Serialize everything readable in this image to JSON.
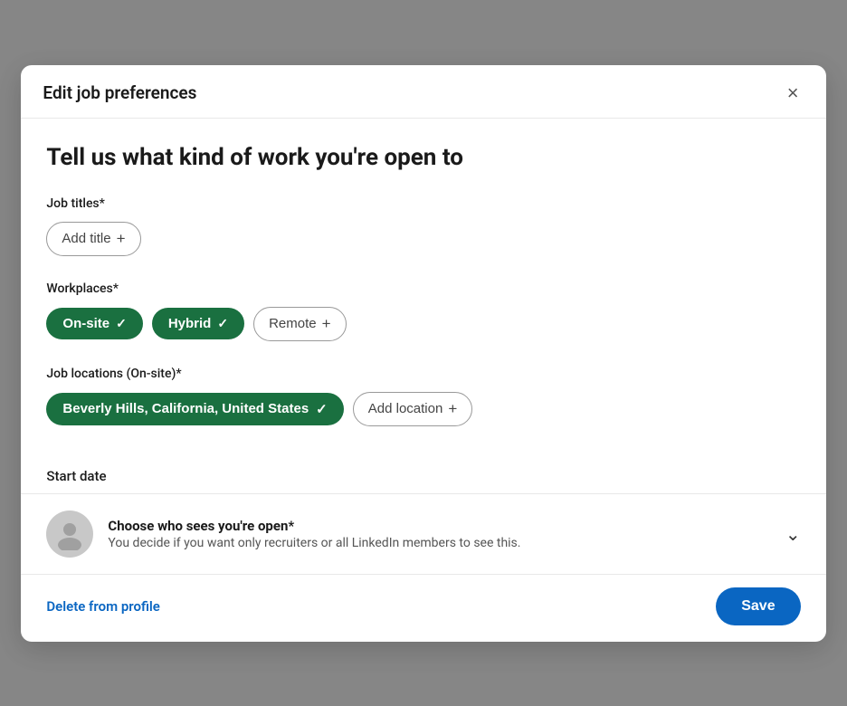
{
  "modal": {
    "title": "Edit job preferences",
    "close_label": "×",
    "heading": "Tell us what kind of work you're open to",
    "job_titles": {
      "label": "Job titles*",
      "add_button": "Add title",
      "plus": "+"
    },
    "workplaces": {
      "label": "Workplaces*",
      "options": [
        {
          "id": "onsite",
          "label": "On-site",
          "selected": true
        },
        {
          "id": "hybrid",
          "label": "Hybrid",
          "selected": true
        },
        {
          "id": "remote",
          "label": "Remote",
          "selected": false
        }
      ]
    },
    "job_locations": {
      "label": "Job locations (On-site)*",
      "selected_location": "Beverly Hills, California, United States",
      "add_button": "Add location",
      "plus": "+"
    },
    "start_date": {
      "label": "Start date"
    },
    "visibility": {
      "title": "Choose who sees you're open*",
      "description": "You decide if you want only recruiters or all LinkedIn members to see this."
    },
    "footer": {
      "delete_label": "Delete from profile",
      "save_label": "Save"
    }
  }
}
